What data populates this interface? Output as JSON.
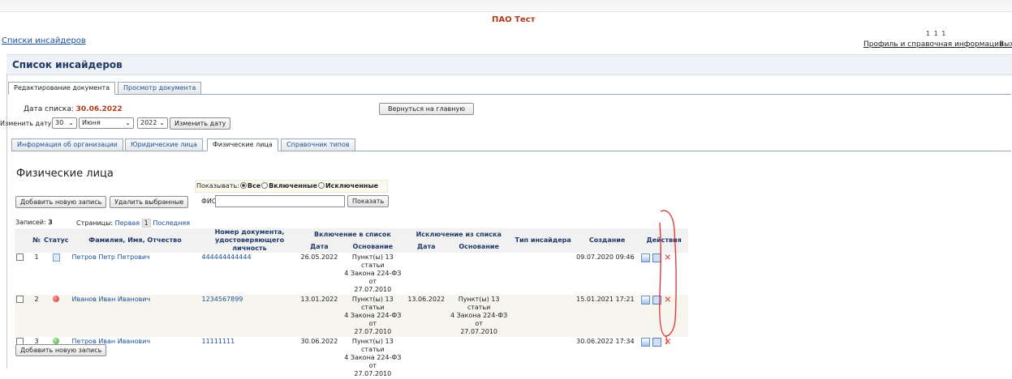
{
  "header": {
    "company": "ПАО Тест",
    "breadcrumb": "Списки инсайдеров",
    "user_number": "1 1 1",
    "profile_link": "Профиль и справочная информация",
    "exit_link": "Выхо"
  },
  "page_title": "Список инсайдеров",
  "doc_tabs": [
    "Редактирование документа",
    "Просмотр документа"
  ],
  "list_date": {
    "label": "Дата списка:",
    "value": "30.06.2022"
  },
  "change_date": {
    "label": "Изменить дату:",
    "day": "30",
    "month": "Июня",
    "year": "2022",
    "button": "Изменить дату"
  },
  "back_button": "Вернуться на главную",
  "section_tabs": [
    "Информация об организации",
    "Юридические лица",
    "Физические лица",
    "Справочник типов"
  ],
  "section_title": "Физические лица",
  "filter": {
    "show_label": "Показывать:",
    "options": [
      "Все",
      "Включенные",
      "Исключенные"
    ],
    "selected": "Все",
    "fio_label": "ФИО:",
    "fio_value": "",
    "show_button": "Показать"
  },
  "buttons": {
    "add_new": "Добавить новую запись",
    "delete_selected": "Удалить выбранные",
    "add_new_bottom": "Добавить новую запись"
  },
  "records": {
    "label": "Записей:",
    "count": "3"
  },
  "pages": {
    "label": "Страницы:",
    "first": "Первая",
    "current": "1",
    "last": "Последняя"
  },
  "table": {
    "headers": {
      "num": "№",
      "status": "Статус",
      "name": "Фамилия, Имя, Отчество",
      "doc_line1": "Номер документа,",
      "doc_line2": "удостоверяющего личность",
      "inclusion": "Включение в список",
      "exclusion": "Исключение из списка",
      "date": "Дата",
      "basis": "Основание",
      "type": "Тип инсайдера",
      "created": "Создание",
      "actions": "Действия"
    },
    "rows": [
      {
        "num": "1",
        "status": "document",
        "name": "Петров Петр Петрович",
        "doc": "444444444444",
        "inc_date": "26.05.2022",
        "inc_basis_1": "Пункт(ы) 13 статьи",
        "inc_basis_2": "4 Закона 224-ФЗ от",
        "inc_basis_3": "27.07.2010",
        "exc_date": "",
        "exc_basis_1": "",
        "exc_basis_2": "",
        "exc_basis_3": "",
        "type": "",
        "created": "09.07.2020 09:46"
      },
      {
        "num": "2",
        "status": "excluded",
        "name": "Иванов Иван Иванович",
        "doc": "1234567899",
        "inc_date": "13.01.2022",
        "inc_basis_1": "Пункт(ы) 13 статьи",
        "inc_basis_2": "4 Закона 224-ФЗ от",
        "inc_basis_3": "27.07.2010",
        "exc_date": "13.06.2022",
        "exc_basis_1": "Пункт(ы) 13 статьи",
        "exc_basis_2": "4 Закона 224-ФЗ от",
        "exc_basis_3": "27.07.2010",
        "type": "",
        "created": "15.01.2021 17:21"
      },
      {
        "num": "3",
        "status": "included",
        "name": "Петров Иван Иванович",
        "doc": "11111111",
        "inc_date": "30.06.2022",
        "inc_basis_1": "Пункт(ы) 13 статьи",
        "inc_basis_2": "4 Закона 224-ФЗ от",
        "inc_basis_3": "27.07.2010",
        "exc_date": "",
        "exc_basis_1": "",
        "exc_basis_2": "",
        "exc_basis_3": "",
        "type": "",
        "created": "30.06.2022 17:34"
      }
    ]
  },
  "colors": {
    "accent_red": "#b23a1a",
    "link_blue": "#1a4f9c",
    "title_navy": "#1f3a68",
    "annotation_red": "#e23a3a"
  }
}
